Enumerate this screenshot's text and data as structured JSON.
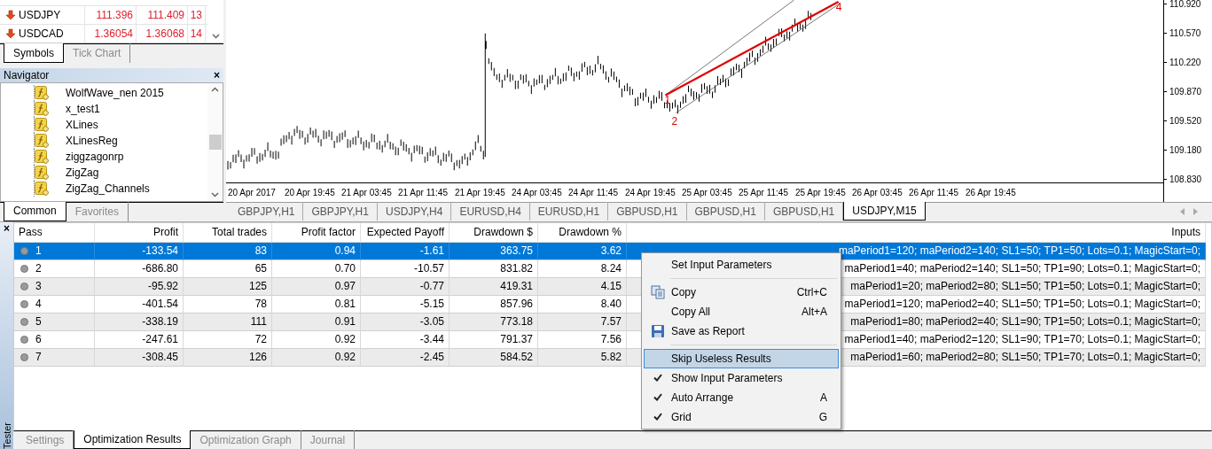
{
  "market_watch": {
    "rows": [
      {
        "symbol": "USDJPY",
        "bid": "111.396",
        "ask": "111.409",
        "spread": "13"
      },
      {
        "symbol": "USDCAD",
        "bid": "1.36054",
        "ask": "1.36068",
        "spread": "14"
      }
    ],
    "tabs": [
      {
        "label": "Symbols",
        "selected": true
      },
      {
        "label": "Tick Chart",
        "selected": false
      }
    ]
  },
  "navigator": {
    "title": "Navigator",
    "close": "×",
    "items": [
      "WolfWave_nen 2015",
      "x_test1",
      "XLines",
      "XLinesReg",
      "ziggzagonrp",
      "ZigZag",
      "ZigZag_Channels"
    ],
    "tabs": [
      {
        "label": "Common",
        "selected": true
      },
      {
        "label": "Favorites",
        "selected": false
      }
    ]
  },
  "chart": {
    "price_labels": [
      "110.920",
      "110.570",
      "110.220",
      "109.870",
      "109.520",
      "109.180",
      "108.830"
    ],
    "time_labels": [
      "20 Apr 2017",
      "20 Apr 19:45",
      "21 Apr 03:45",
      "21 Apr 11:45",
      "21 Apr 19:45",
      "24 Apr 03:45",
      "24 Apr 11:45",
      "24 Apr 19:45",
      "25 Apr 03:45",
      "25 Apr 11:45",
      "25 Apr 19:45",
      "26 Apr 03:45",
      "26 Apr 11:45",
      "26 Apr 19:45"
    ],
    "wave_labels": [
      "1",
      "2",
      "4"
    ],
    "tabs": [
      {
        "label": "GBPJPY,H1",
        "selected": false
      },
      {
        "label": "GBPJPY,H1",
        "selected": false
      },
      {
        "label": "USDJPY,H4",
        "selected": false
      },
      {
        "label": "EURUSD,H4",
        "selected": false
      },
      {
        "label": "EURUSD,H1",
        "selected": false
      },
      {
        "label": "GBPUSD,H1",
        "selected": false
      },
      {
        "label": "GBPUSD,H1",
        "selected": false
      },
      {
        "label": "GBPUSD,H1",
        "selected": false
      },
      {
        "label": "USDJPY,M15",
        "selected": true
      }
    ]
  },
  "tester": {
    "title": "Tester",
    "close": "×",
    "columns": [
      "Pass",
      "Profit",
      "Total trades",
      "Profit factor",
      "Expected Payoff",
      "Drawdown $",
      "Drawdown %",
      "Inputs"
    ],
    "rows": [
      {
        "selected": true,
        "cells": [
          "1",
          "-133.54",
          "83",
          "0.94",
          "-1.61",
          "363.75",
          "3.62",
          "maPeriod1=120; maPeriod2=140; SL1=50; TP1=50; Lots=0.1; MagicStart=0;"
        ]
      },
      {
        "selected": false,
        "cells": [
          "2",
          "-686.80",
          "65",
          "0.70",
          "-10.57",
          "831.82",
          "8.24",
          "maPeriod1=40; maPeriod2=140; SL1=50; TP1=90; Lots=0.1; MagicStart=0;"
        ]
      },
      {
        "selected": false,
        "cells": [
          "3",
          "-95.92",
          "125",
          "0.97",
          "-0.77",
          "419.31",
          "4.15",
          "maPeriod1=20; maPeriod2=80; SL1=50; TP1=50; Lots=0.1; MagicStart=0;"
        ]
      },
      {
        "selected": false,
        "cells": [
          "4",
          "-401.54",
          "78",
          "0.81",
          "-5.15",
          "857.96",
          "8.40",
          "maPeriod1=120; maPeriod2=40; SL1=50; TP1=50; Lots=0.1; MagicStart=0;"
        ]
      },
      {
        "selected": false,
        "cells": [
          "5",
          "-338.19",
          "111",
          "0.91",
          "-3.05",
          "773.18",
          "7.57",
          "maPeriod1=80; maPeriod2=40; SL1=90; TP1=50; Lots=0.1; MagicStart=0;"
        ]
      },
      {
        "selected": false,
        "cells": [
          "6",
          "-247.61",
          "72",
          "0.92",
          "-3.44",
          "791.37",
          "7.56",
          "maPeriod1=40; maPeriod2=120; SL1=90; TP1=70; Lots=0.1; MagicStart=0;"
        ]
      },
      {
        "selected": false,
        "cells": [
          "7",
          "-308.45",
          "126",
          "0.92",
          "-2.45",
          "584.52",
          "5.82",
          "maPeriod1=60; maPeriod2=80; SL1=50; TP1=70; Lots=0.1; MagicStart=0;"
        ]
      }
    ],
    "tabs": [
      {
        "label": "Settings",
        "selected": false
      },
      {
        "label": "Optimization Results",
        "selected": true
      },
      {
        "label": "Optimization Graph",
        "selected": false
      },
      {
        "label": "Journal",
        "selected": false
      }
    ]
  },
  "context_menu": {
    "items": [
      {
        "kind": "item",
        "label": "Set Input Parameters",
        "checked": false,
        "selected": false
      },
      {
        "kind": "separator"
      },
      {
        "kind": "copy-item",
        "label": "Copy",
        "shortcut": "Ctrl+C",
        "checked": false,
        "selected": false
      },
      {
        "kind": "item",
        "label": "Copy All",
        "shortcut": "Alt+A",
        "checked": false,
        "selected": false
      },
      {
        "kind": "save-item",
        "label": "Save as Report",
        "checked": false,
        "selected": false
      },
      {
        "kind": "separator"
      },
      {
        "kind": "item",
        "label": "Skip Useless Results",
        "checked": false,
        "selected": true
      },
      {
        "kind": "item",
        "label": "Show Input Parameters",
        "checked": true,
        "selected": false
      },
      {
        "kind": "item",
        "label": "Auto Arrange",
        "shortcut": "A",
        "checked": true,
        "selected": false
      },
      {
        "kind": "item",
        "label": "Grid",
        "shortcut": "G",
        "checked": true,
        "selected": false
      }
    ]
  }
}
